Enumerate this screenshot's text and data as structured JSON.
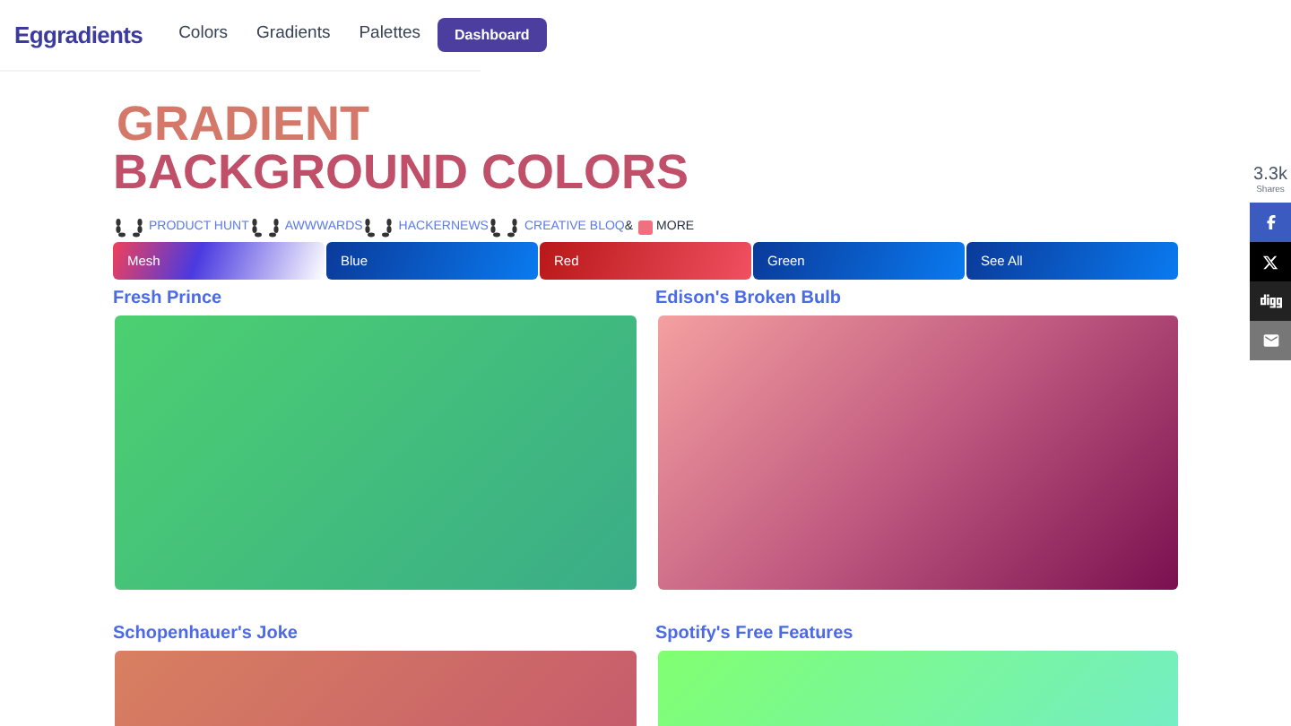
{
  "nav": {
    "logo": "Eggradients",
    "links": [
      "Colors",
      "Gradients",
      "Palettes"
    ],
    "cta": "Dashboard"
  },
  "hero": {
    "line1": "GRADIENT",
    "line2": "BACKGROUND COLORS"
  },
  "featured": {
    "items": [
      "PRODUCT HUNT",
      "AWWWARDS",
      "HACKERNEWS",
      "CREATIVE BLOQ"
    ],
    "suffix": "&",
    "more": "MORE"
  },
  "filters": [
    {
      "label": "Mesh"
    },
    {
      "label": "Blue"
    },
    {
      "label": "Red"
    },
    {
      "label": "Green"
    },
    {
      "label": "See All"
    }
  ],
  "cards": [
    {
      "title": "Fresh Prince"
    },
    {
      "title": "Edison's Broken Bulb"
    },
    {
      "title": "Schopenhauer's Joke"
    },
    {
      "title": "Spotify's Free Features"
    }
  ],
  "share": {
    "count": "3.3k",
    "label": "Shares"
  }
}
